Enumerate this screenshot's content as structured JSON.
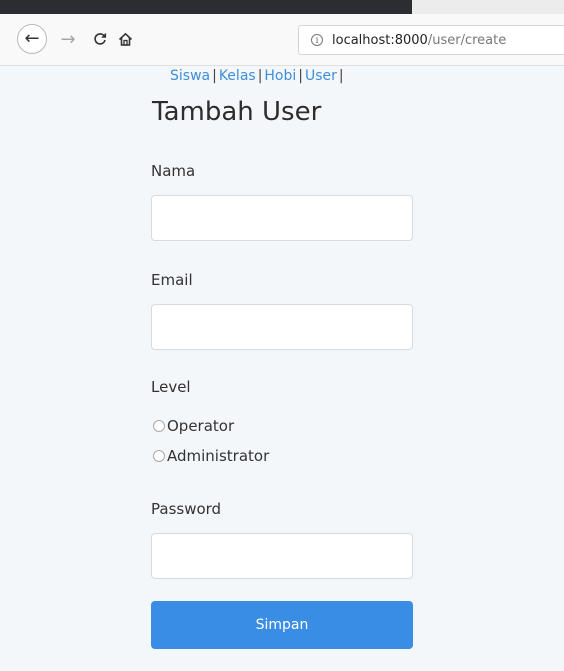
{
  "browser": {
    "url_host": "localhost:8000",
    "url_path": "/user/create"
  },
  "nav": {
    "links": [
      "Siswa",
      "Kelas",
      "Hobi",
      "User"
    ],
    "separator": "|"
  },
  "form": {
    "title": "Tambah User",
    "name_label": "Nama",
    "name_value": "",
    "email_label": "Email",
    "email_value": "",
    "level_label": "Level",
    "level_options": [
      "Operator",
      "Administrator"
    ],
    "level_selected": null,
    "password_label": "Password",
    "password_value": "",
    "submit_label": "Simpan"
  },
  "colors": {
    "link": "#3d8ed8",
    "button": "#3a8de4",
    "page_bg": "#f4f7fa"
  },
  "icons": {
    "back": "back-arrow-icon",
    "forward": "forward-arrow-icon",
    "reload": "reload-icon",
    "home": "home-icon",
    "site_info": "info-icon"
  }
}
